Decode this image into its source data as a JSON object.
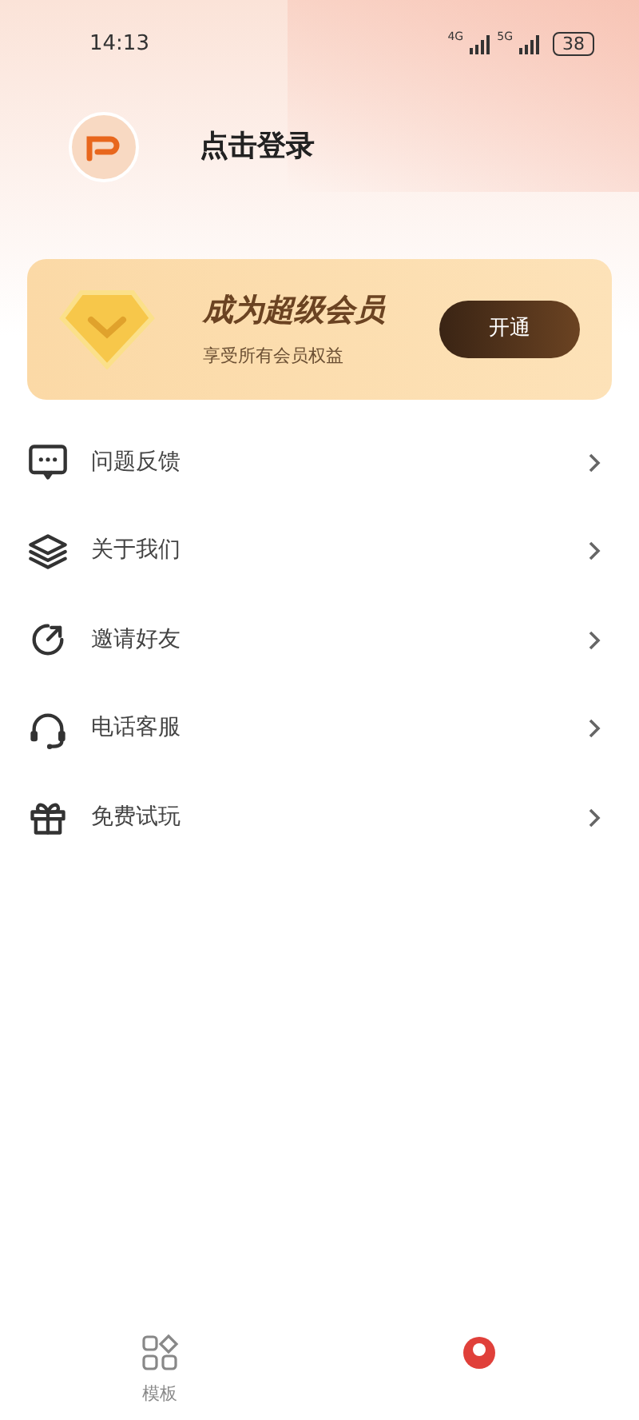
{
  "status_bar": {
    "time": "14:13",
    "network_1": "4G",
    "network_2": "5G",
    "battery": "38"
  },
  "profile": {
    "login_text": "点击登录"
  },
  "vip_banner": {
    "title": "成为超级会员",
    "subtitle": "享受所有会员权益",
    "button": "开通"
  },
  "menu": [
    {
      "kind": "feedback",
      "label": "问题反馈"
    },
    {
      "kind": "about",
      "label": "关于我们"
    },
    {
      "kind": "invite",
      "label": "邀请好友"
    },
    {
      "kind": "support",
      "label": "电话客服"
    },
    {
      "kind": "gift",
      "label": "免费试玩"
    }
  ],
  "tab_bar": [
    {
      "kind": "templates",
      "label": "模板",
      "selected": false
    },
    {
      "kind": "profile",
      "selected": true
    }
  ]
}
